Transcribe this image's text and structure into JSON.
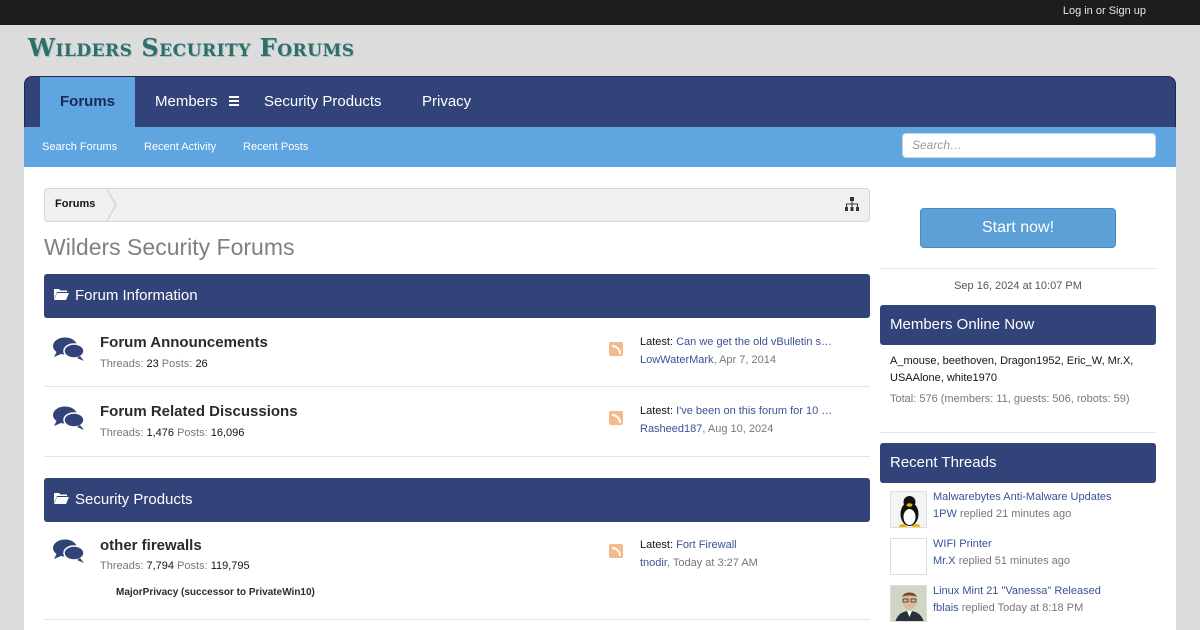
{
  "topbar": {
    "login_label": "Log in or Sign up"
  },
  "logo": {
    "text": "Wilders Security Forums"
  },
  "nav": {
    "tabs": [
      {
        "label": "Forums",
        "active": true
      },
      {
        "label": "Members"
      },
      {
        "label": "Security Products"
      },
      {
        "label": "Privacy"
      }
    ]
  },
  "subnav": {
    "links": [
      "Search Forums",
      "Recent Activity",
      "Recent Posts"
    ],
    "search_placeholder": "Search…"
  },
  "breadcrumb": {
    "item": "Forums"
  },
  "page_title": "Wilders Security Forums",
  "categories": [
    {
      "title": "Forum Information",
      "forums": [
        {
          "name": "Forum Announcements",
          "threads_label": "Threads:",
          "threads": "23",
          "posts_label": "Posts:",
          "posts": "26",
          "latest_label": "Latest:",
          "latest_title": "Can we get the old vBulletin s…",
          "latest_user": "LowWaterMark",
          "latest_date": "Apr 7, 2014"
        },
        {
          "name": "Forum Related Discussions",
          "threads_label": "Threads:",
          "threads": "1,476",
          "posts_label": "Posts:",
          "posts": "16,096",
          "latest_label": "Latest:",
          "latest_title": "I've been on this forum for 10 …",
          "latest_user": "Rasheed187",
          "latest_date": "Aug 10, 2024"
        }
      ]
    },
    {
      "title": "Security Products",
      "forums": [
        {
          "name": "other firewalls",
          "threads_label": "Threads:",
          "threads": "7,794",
          "posts_label": "Posts:",
          "posts": "119,795",
          "latest_label": "Latest:",
          "latest_title": "Fort Firewall",
          "latest_user": "tnodir",
          "latest_date": "Today at 3:27 AM",
          "subforum": "MajorPrivacy (successor to PrivateWin10)"
        }
      ]
    }
  ],
  "sidebar": {
    "start_label": "Start now!",
    "date": "Sep 16, 2024 at 10:07 PM",
    "members_online_title": "Members Online Now",
    "members_online_list": "A_mouse, beethoven, Dragon1952, Eric_W, Mr.X, USAAlone, white1970",
    "members_online_total": "Total: 576 (members: 11, guests: 506, robots: 59)",
    "recent_threads_title": "Recent Threads",
    "recent_threads": [
      {
        "title": "Malwarebytes Anti-Malware Updates",
        "user": "1PW",
        "action": "replied 21 minutes ago",
        "avatar": "tux-avatar"
      },
      {
        "title": "WIFI Printer",
        "user": "Mr.X",
        "action": "replied 51 minutes ago",
        "avatar": "blank-avatar"
      },
      {
        "title": "Linux Mint 21 \"Vanessa\" Released",
        "user": "fblais",
        "action": "replied Today at 8:18 PM",
        "avatar": "person-avatar"
      }
    ]
  },
  "colors": {
    "nav_bg": "#32437a",
    "accent": "#5fa6e0",
    "link": "#3a5296"
  }
}
